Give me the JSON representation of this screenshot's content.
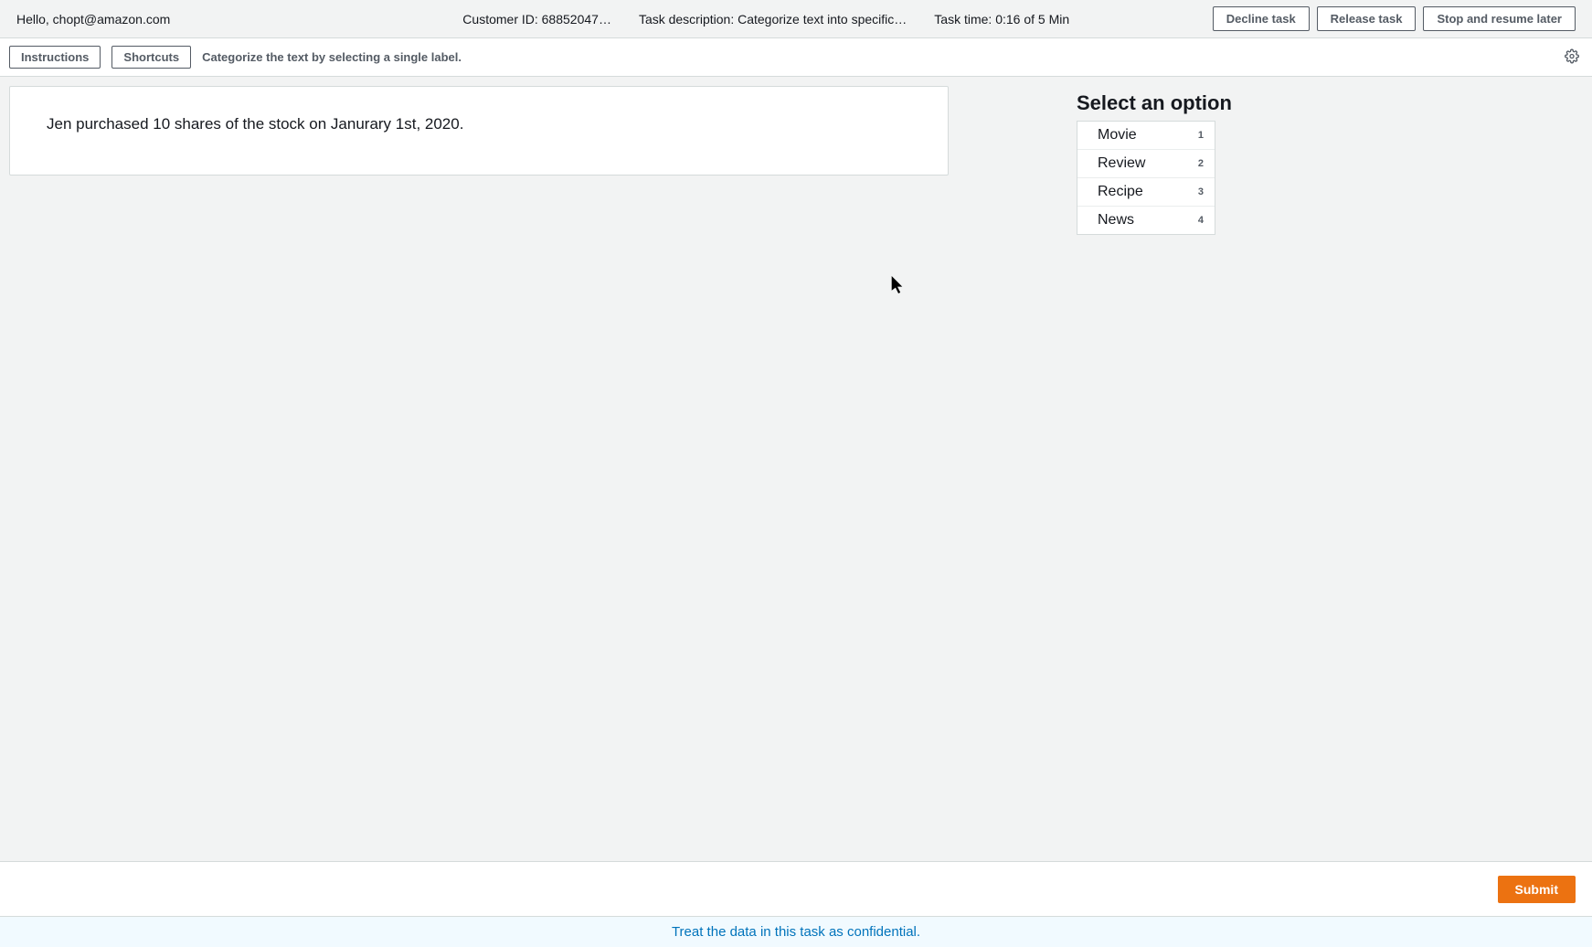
{
  "header": {
    "greeting": "Hello, chopt@amazon.com",
    "customer_id": "Customer ID: 68852047…",
    "task_description": "Task description: Categorize text into specific…",
    "task_time": "Task time: 0:16 of 5 Min",
    "decline_label": "Decline task",
    "release_label": "Release task",
    "stop_label": "Stop and resume later"
  },
  "subbar": {
    "instructions_label": "Instructions",
    "shortcuts_label": "Shortcuts",
    "hint": "Categorize the text by selecting a single label."
  },
  "task": {
    "text": "Jen purchased 10 shares of the stock on Janurary 1st, 2020."
  },
  "options": {
    "title": "Select an option",
    "items": [
      {
        "label": "Movie",
        "key": "1"
      },
      {
        "label": "Review",
        "key": "2"
      },
      {
        "label": "Recipe",
        "key": "3"
      },
      {
        "label": "News",
        "key": "4"
      }
    ]
  },
  "footer": {
    "submit_label": "Submit"
  },
  "banner": {
    "text": "Treat the data in this task as confidential."
  }
}
